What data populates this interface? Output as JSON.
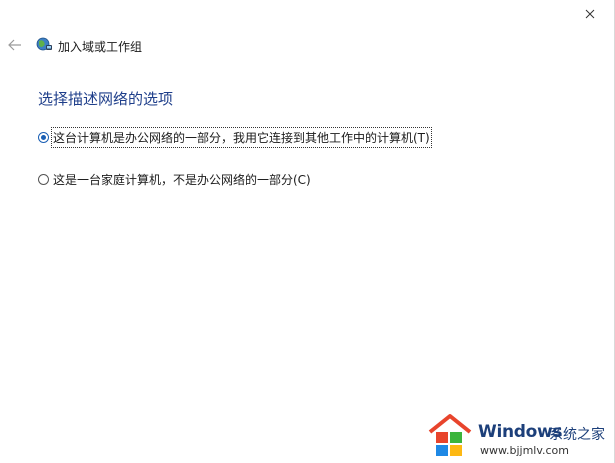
{
  "window": {
    "close_icon": "close-icon",
    "back_icon": "back-arrow-icon",
    "app_icon": "network-globe-icon",
    "title": "加入域或工作组"
  },
  "content": {
    "heading": "选择描述网络的选项",
    "options": [
      {
        "label": "这台计算机是办公网络的一部分，我用它连接到其他工作中的计算机(T)",
        "checked": true
      },
      {
        "label": "这是一台家庭计算机，不是办公网络的一部分(C)",
        "checked": false
      }
    ]
  },
  "watermark": {
    "brand": "Windows",
    "brand_cn": "系统之家",
    "url": "www.bjjmlv.com",
    "logo_colors": [
      "#e8442c",
      "#3bb43c",
      "#1e88e5",
      "#fdb813"
    ]
  }
}
